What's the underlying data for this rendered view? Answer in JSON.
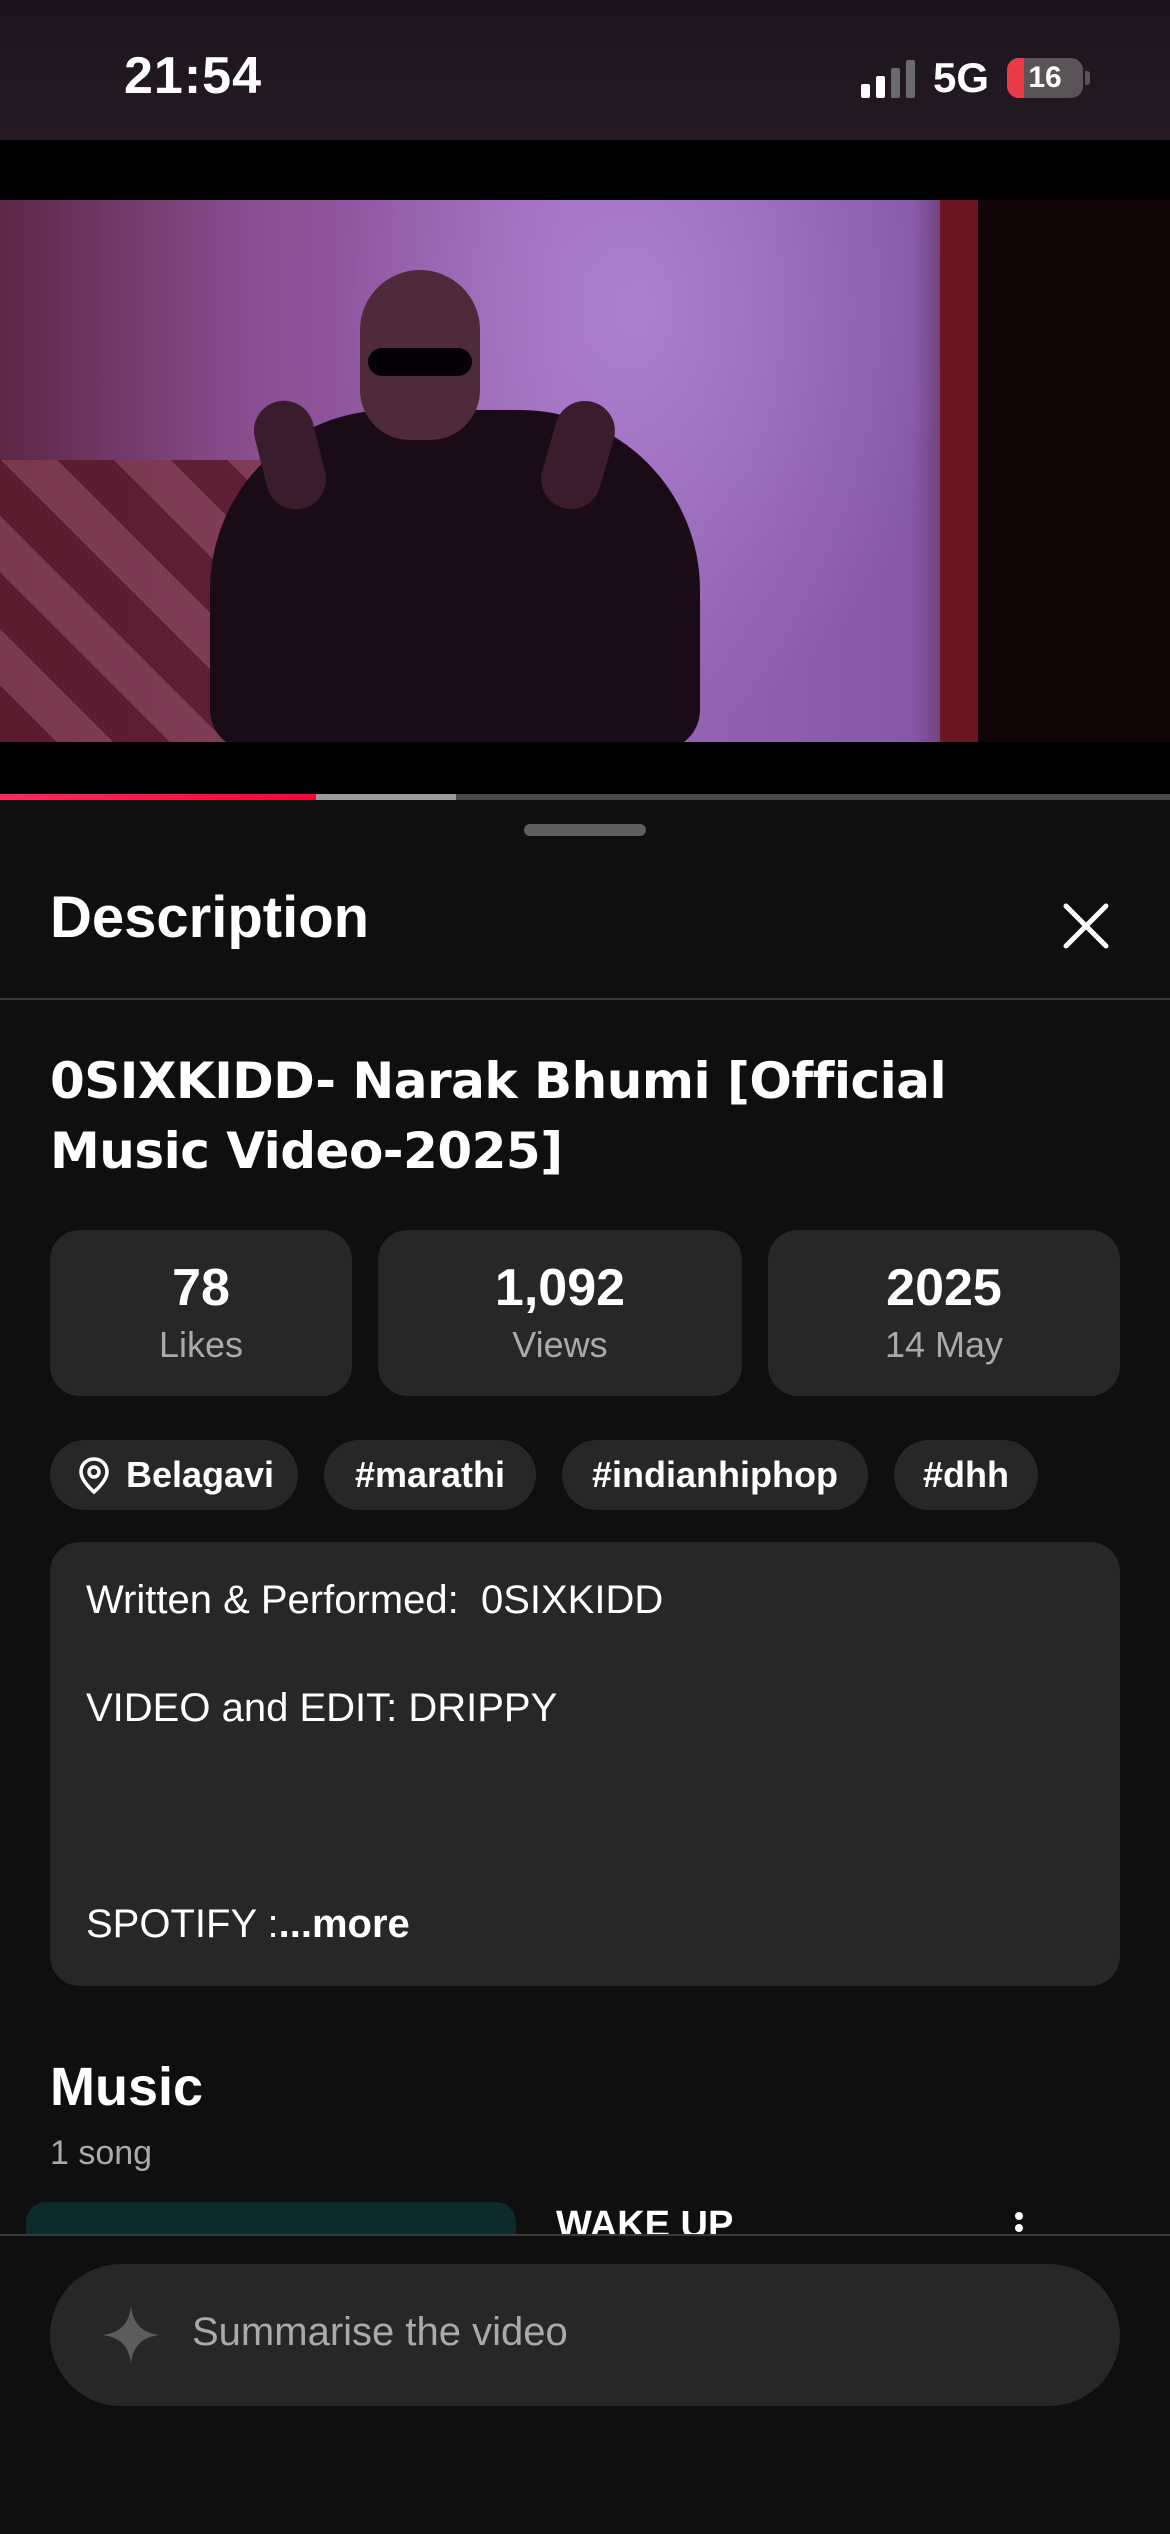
{
  "status_bar": {
    "time": "21:54",
    "network": "5G",
    "battery": "16",
    "signal_bars_active": 2,
    "signal_bars_total": 4
  },
  "player": {
    "progress_played": 0.27,
    "progress_buffered": 0.39
  },
  "sheet": {
    "title": "Description",
    "close_icon": "close-icon",
    "video_title": "0SIXKIDD- Narak Bhumi [Official Music Video-2025]",
    "stats": [
      {
        "value": "78",
        "label": "Likes"
      },
      {
        "value": "1,092",
        "label": "Views"
      },
      {
        "value": "2025",
        "label": "14 May"
      }
    ],
    "tags": [
      {
        "label": "Belagavi",
        "icon": "location-pin-icon"
      },
      {
        "label": "#marathi"
      },
      {
        "label": "#indianhiphop"
      },
      {
        "label": "#dhh"
      }
    ],
    "description": {
      "line1": "Written & Performed:  0SIXKIDD",
      "line2": "VIDEO and EDIT: DRIPPY",
      "line3": "SPOTIFY :",
      "more": "...more"
    },
    "music": {
      "title": "Music",
      "subtitle": "1 song",
      "song_title": "WAKE UP"
    }
  },
  "summarise": {
    "placeholder": "Summarise the video",
    "icon": "sparkle-icon"
  },
  "colors": {
    "accent_red": "#ff0033",
    "surface": "#272727",
    "background": "#0f0f0f"
  }
}
